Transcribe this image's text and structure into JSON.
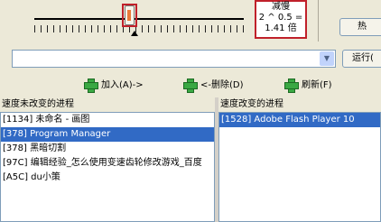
{
  "speed": {
    "label": "减慢",
    "formula": "2 ^ 0.5 =",
    "multiplier": "1.41 倍"
  },
  "buttons": {
    "hotkey": "热",
    "run": "运行("
  },
  "actions": [
    {
      "label": "加入(A)->",
      "icon": "green-add-icon"
    },
    {
      "label": "<-删除(D)",
      "icon": "green-remove-icon"
    },
    {
      "label": "刷新(F)",
      "icon": "green-refresh-icon"
    }
  ],
  "left_panel": {
    "title": "速度未改变的进程",
    "items": [
      "[1134] 未命名 - 画图",
      "[378] Program Manager",
      "[378] 黑暗切割",
      "[97C] 编辑经验_怎么使用变速齿轮修改游戏_百度",
      "[A5C] du小策"
    ],
    "selected_index": 1
  },
  "right_panel": {
    "title": "速度改变的进程",
    "items": [
      "[1528] Adobe Flash Player 10"
    ],
    "selected_index": 0
  }
}
